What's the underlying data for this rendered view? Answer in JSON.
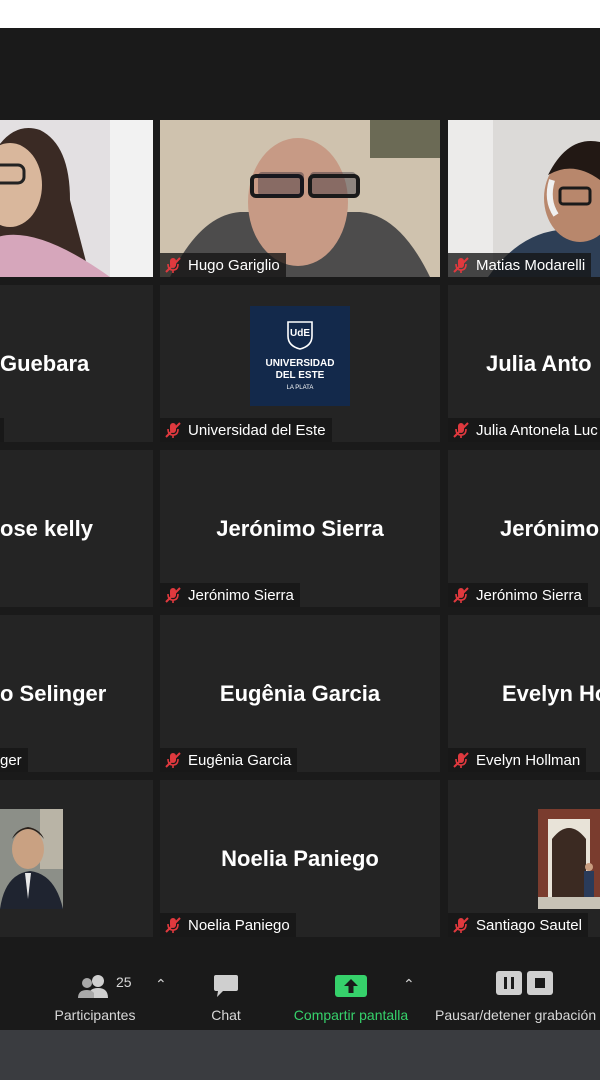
{
  "tiles": [
    {
      "name": "Hugo Gariglio"
    },
    {
      "name": "Matias Modarelli"
    },
    {
      "big": "Guebara"
    },
    {
      "name": "Universidad del Este"
    },
    {
      "big": "Julia Anto",
      "name": "Julia Antonela Luc"
    },
    {
      "big": "ose kelly"
    },
    {
      "big": "Jerónimo Sierra",
      "name": "Jerónimo Sierra"
    },
    {
      "big": "Jerónimo",
      "name": "Jerónimo Sierra"
    },
    {
      "big": "o Selinger",
      "name": "ger"
    },
    {
      "big": "Eugênia Garcia",
      "name": "Eugênia Garcia"
    },
    {
      "big": "Evelyn Ho",
      "name": "Evelyn Hollman"
    },
    {
      "big": "Noelia Paniego",
      "name": "Noelia Paniego"
    },
    {
      "name": "Santiago Sautel"
    }
  ],
  "logo": {
    "mark": "UdE",
    "line1": "UNIVERSIDAD",
    "line2": "DEL ESTE",
    "line3": "LA PLATA"
  },
  "toolbar": {
    "participants_label": "Participantes",
    "participants_count": "25",
    "chat_label": "Chat",
    "share_label": "Compartir pantalla",
    "record_label": "Pausar/detener grabación"
  },
  "colors": {
    "share_green": "#36d16b",
    "tile_bg": "#242424",
    "mute_red": "#e0393e"
  }
}
